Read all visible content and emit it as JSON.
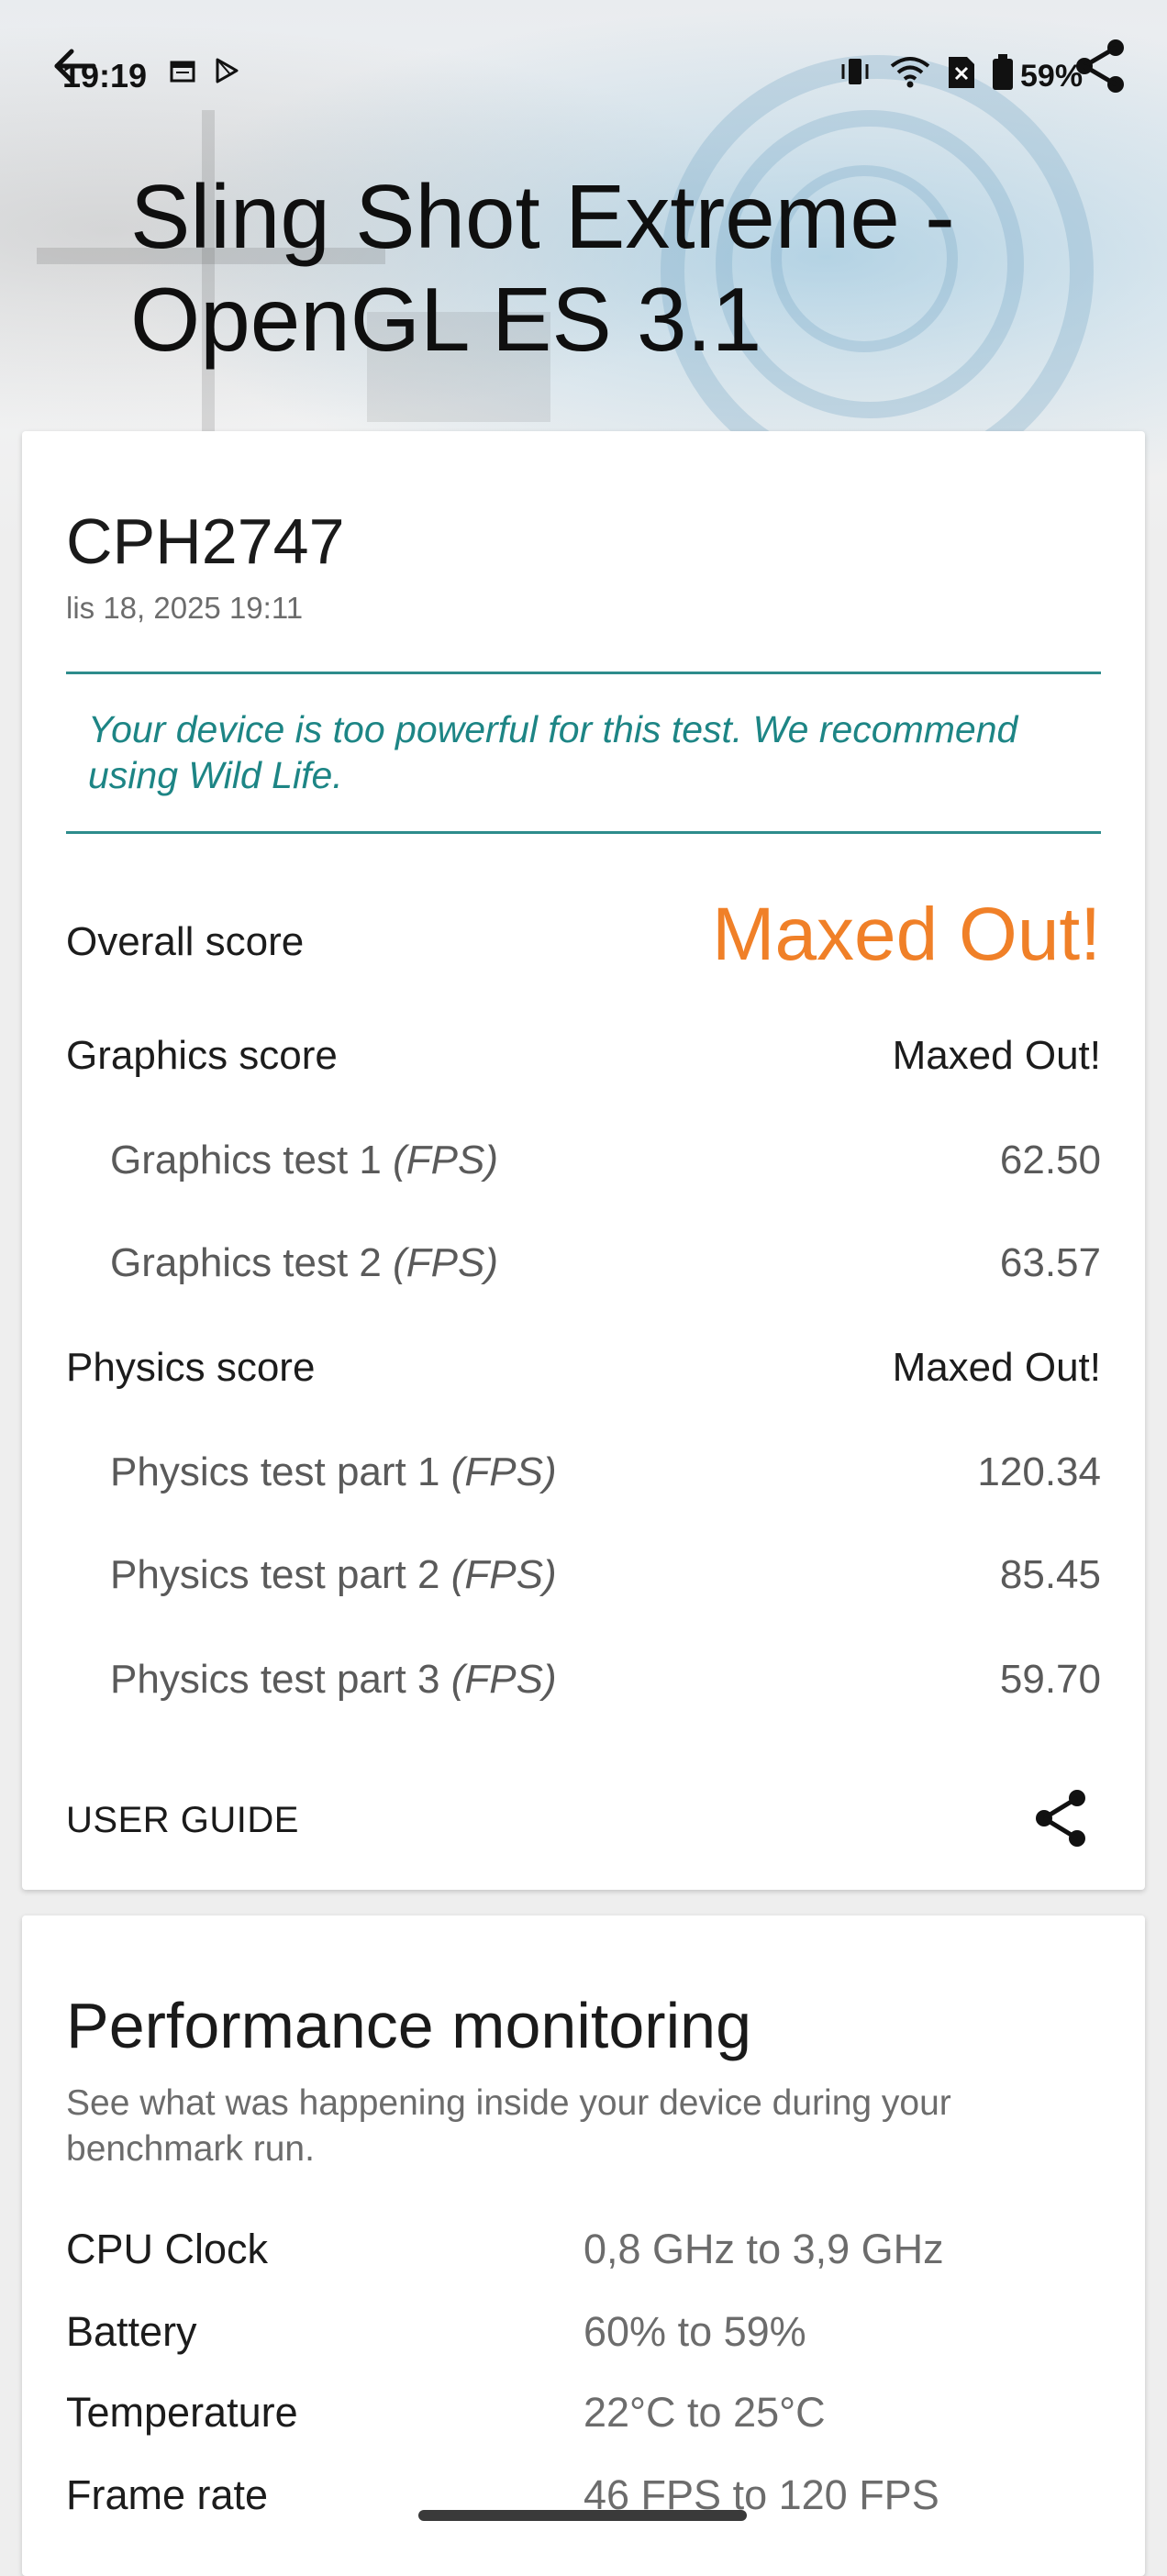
{
  "status_bar": {
    "time": "19:19",
    "battery": "59%"
  },
  "header": {
    "title": "Sling Shot Extreme - OpenGL ES 3.1"
  },
  "result": {
    "device": "CPH2747",
    "date": "lis 18, 2025 19:11",
    "warning": "Your device is too powerful for this test. We recommend using Wild Life.",
    "overall_label": "Overall score",
    "overall_value": "Maxed Out!",
    "graphics_label": "Graphics score",
    "graphics_value": "Maxed Out!",
    "graphics_tests": [
      {
        "label": "Graphics test 1",
        "unit": "(FPS)",
        "value": "62.50"
      },
      {
        "label": "Graphics test 2",
        "unit": "(FPS)",
        "value": "63.57"
      }
    ],
    "physics_label": "Physics score",
    "physics_value": "Maxed Out!",
    "physics_tests": [
      {
        "label": "Physics test part 1",
        "unit": "(FPS)",
        "value": "120.34"
      },
      {
        "label": "Physics test part 2",
        "unit": "(FPS)",
        "value": "85.45"
      },
      {
        "label": "Physics test part 3",
        "unit": "(FPS)",
        "value": "59.70"
      }
    ],
    "user_guide": "USER GUIDE"
  },
  "performance": {
    "title": "Performance monitoring",
    "description": "See what was happening inside your device during your benchmark run.",
    "rows": [
      {
        "label": "CPU Clock",
        "value": "0,8 GHz to 3,9 GHz"
      },
      {
        "label": "Battery",
        "value": "60% to 59%"
      },
      {
        "label": "Temperature",
        "value": "22°C to 25°C"
      },
      {
        "label": "Frame rate",
        "value": "46 FPS to 120 FPS"
      }
    ]
  },
  "icons": {
    "back": "back-arrow-icon",
    "share": "share-icon",
    "accent_color": "#f08028",
    "teal_color": "#2d8c8c"
  }
}
